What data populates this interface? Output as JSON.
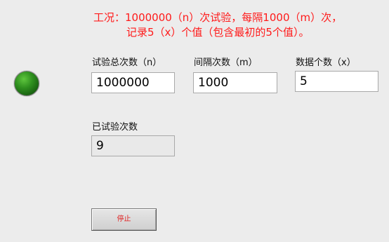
{
  "instructions": {
    "line1": "工况：1000000（n）次试验，每隔1000（m）次，",
    "line2": "记录5（x）个值（包含最初的5个值）。"
  },
  "indicator": {
    "color": "#2f8f1f",
    "state": "on"
  },
  "controls": {
    "n": {
      "label": "试验总次数（n）",
      "value": "1000000"
    },
    "m": {
      "label": "间隔次数（m）",
      "value": "1000"
    },
    "x": {
      "label": "数据个数（x）",
      "value": "5"
    }
  },
  "progress": {
    "label": "已试验次数",
    "value": "9"
  },
  "stop_button": {
    "label": "停止"
  }
}
